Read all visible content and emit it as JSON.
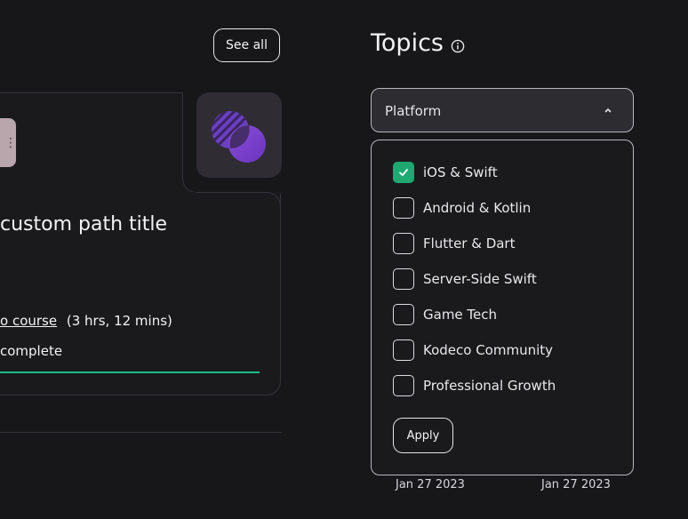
{
  "header": {
    "see_all_label": "See all"
  },
  "card": {
    "menu_glyph": "⋮",
    "title": "custom path title",
    "course_link": "o course",
    "duration": "(3 hrs, 12 mins)",
    "progress_text": "complete",
    "progress_fraction": 1.0,
    "accent_color": "#1fba83"
  },
  "topics": {
    "title": "Topics",
    "info_icon": "info-icon",
    "select": {
      "value": "Platform",
      "expanded": true
    },
    "options": [
      {
        "label": "iOS & Swift",
        "checked": true
      },
      {
        "label": "Android & Kotlin",
        "checked": false
      },
      {
        "label": "Flutter & Dart",
        "checked": false
      },
      {
        "label": "Server-Side Swift",
        "checked": false
      },
      {
        "label": "Game Tech",
        "checked": false
      },
      {
        "label": "Kodeco Community",
        "checked": false
      },
      {
        "label": "Professional Growth",
        "checked": false
      }
    ],
    "apply_label": "Apply",
    "check_color": "#1fa872"
  },
  "dates": [
    "Jan 27 2023",
    "Jan 27 2023"
  ]
}
